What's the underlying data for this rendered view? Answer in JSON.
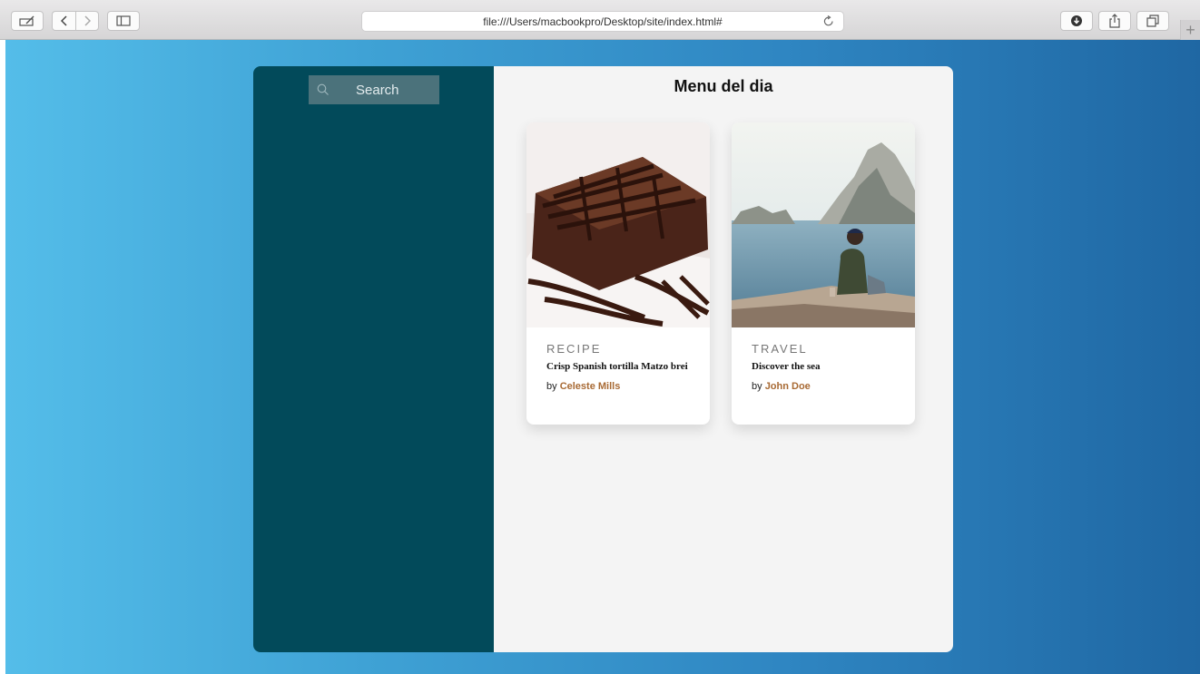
{
  "browser": {
    "url": "file:///Users/macbookpro/Desktop/site/index.html#",
    "new_tab_label": "+"
  },
  "sidebar": {
    "search": {
      "placeholder": "Search"
    }
  },
  "main": {
    "title": "Menu del dia",
    "cards": [
      {
        "category": "RECIPE",
        "title": "Crisp Spanish tortilla Matzo brei",
        "by": "by",
        "author": "Celeste Mills",
        "image": "brownie-image"
      },
      {
        "category": "TRAVEL",
        "title": "Discover the sea",
        "by": "by",
        "author": "John Doe",
        "image": "sea-cliff-image"
      }
    ]
  },
  "colors": {
    "sidebar_bg": "#024a5a",
    "author_accent": "#a86a34",
    "background_gradient_start": "#54bde9",
    "background_gradient_end": "#1f67a3"
  }
}
